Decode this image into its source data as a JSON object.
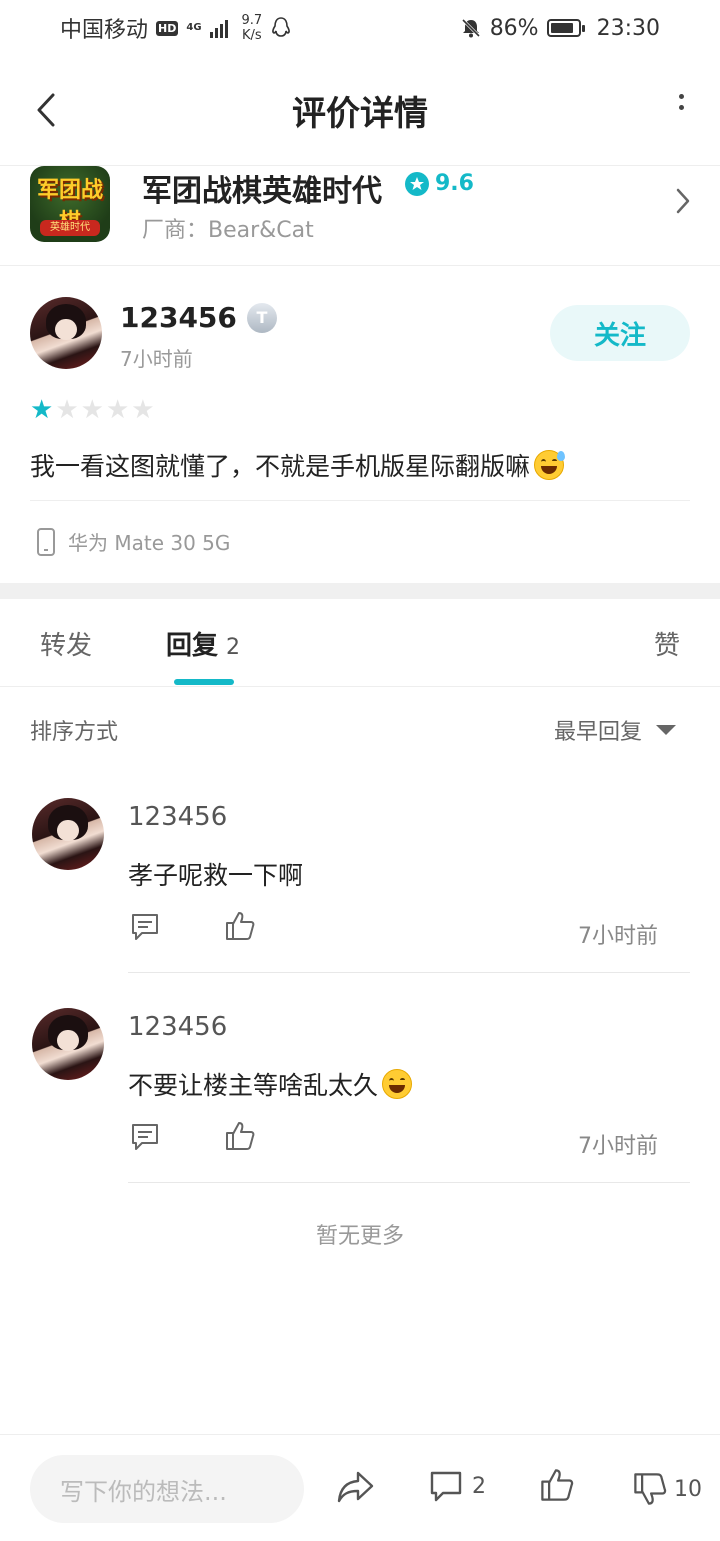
{
  "status": {
    "carrier": "中国移动",
    "hd": "HD",
    "net": "4G",
    "speed_value": "9.7",
    "speed_unit": "K/s",
    "battery": "86%",
    "battery_level": 0.86,
    "time": "23:30"
  },
  "nav": {
    "title": "评价详情"
  },
  "app": {
    "name": "军团战棋英雄时代",
    "rating": "9.6",
    "vendor": "厂商：Bear&Cat",
    "icon_text": "军团战棋",
    "icon_banner": "英雄时代"
  },
  "review": {
    "user": "123456",
    "badge": "T",
    "time": "7小时前",
    "follow_label": "关注",
    "stars_filled": 1,
    "stars_total": 5,
    "text": "我一看这图就懂了，不就是手机版星际翻版嘛",
    "device": "华为 Mate 30 5G"
  },
  "tabs": {
    "forward": "转发",
    "reply": "回复",
    "reply_count": "2",
    "like": "赞"
  },
  "sort": {
    "label": "排序方式",
    "selected": "最早回复"
  },
  "replies": [
    {
      "user": "123456",
      "text": "孝子呢救一下啊",
      "time": "7小时前"
    },
    {
      "user": "123456",
      "text": "不要让楼主等啥乱太久",
      "time": "7小时前"
    }
  ],
  "no_more": "暂无更多",
  "bottom": {
    "placeholder": "写下你的想法...",
    "comment_count": "2",
    "dislike_count": "10"
  },
  "colors": {
    "accent": "#14b9c8",
    "star_filled": "#14b9c8",
    "star_empty": "#e5e5e5"
  }
}
